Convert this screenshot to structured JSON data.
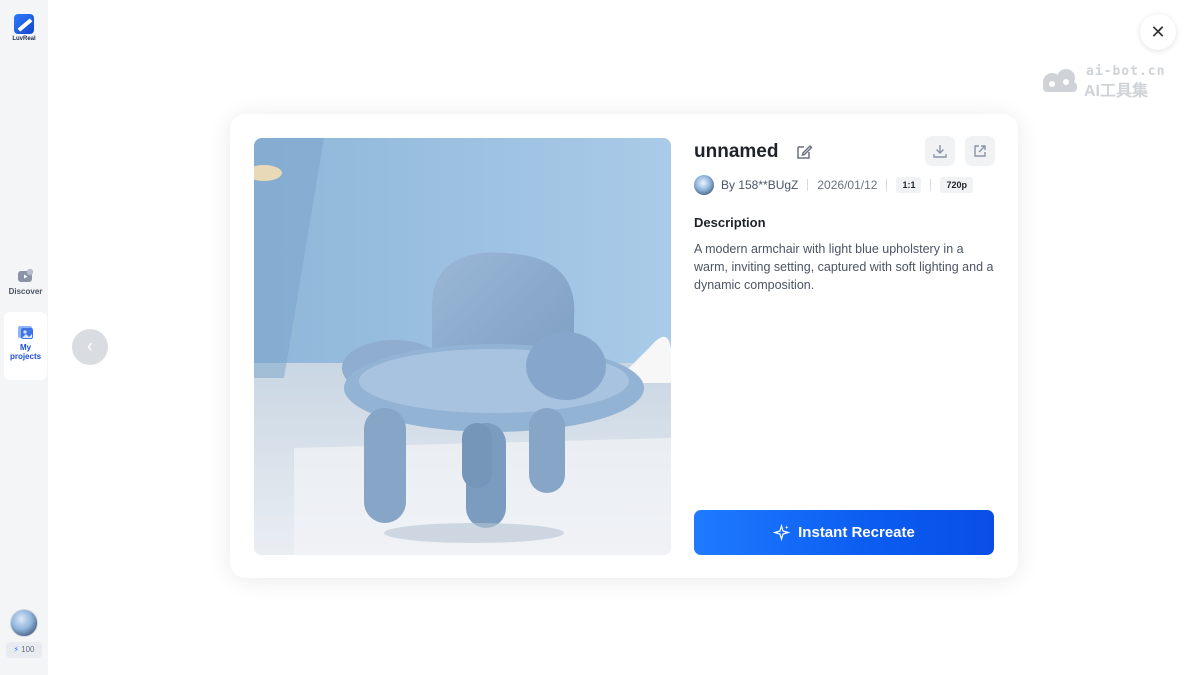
{
  "sidebar": {
    "logo_text": "LuvReal",
    "items": [
      {
        "label": "Discover",
        "icon": "discover-icon"
      },
      {
        "label": "My projects",
        "icon": "projects-icon",
        "active": true
      }
    ],
    "credits": "100"
  },
  "watermark": {
    "line1": "ai-bot.cn",
    "line2": "AI工具集"
  },
  "card": {
    "title": "unnamed",
    "author": "By 158**BUgZ",
    "date": "2026/01/12",
    "aspect_ratio": "1:1",
    "resolution": "720p",
    "description_label": "Description",
    "description": "A modern armchair with light blue upholstery in a warm, inviting setting, captured with soft lighting and a dynamic composition.",
    "cta_label": "Instant Recreate"
  },
  "colors": {
    "accent": "#0b5cf0",
    "sidebar_bg": "#f4f5f7",
    "active_nav": "#1a4fd6"
  }
}
